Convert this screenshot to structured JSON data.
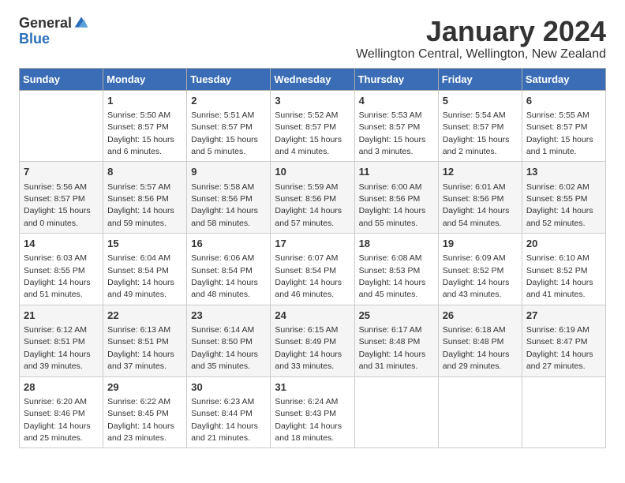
{
  "header": {
    "logo": {
      "general": "General",
      "blue": "Blue"
    },
    "month": "January 2024",
    "location": "Wellington Central, Wellington, New Zealand"
  },
  "columns": [
    "Sunday",
    "Monday",
    "Tuesday",
    "Wednesday",
    "Thursday",
    "Friday",
    "Saturday"
  ],
  "weeks": [
    [
      {
        "day": "",
        "info": ""
      },
      {
        "day": "1",
        "info": "Sunrise: 5:50 AM\nSunset: 8:57 PM\nDaylight: 15 hours\nand 6 minutes."
      },
      {
        "day": "2",
        "info": "Sunrise: 5:51 AM\nSunset: 8:57 PM\nDaylight: 15 hours\nand 5 minutes."
      },
      {
        "day": "3",
        "info": "Sunrise: 5:52 AM\nSunset: 8:57 PM\nDaylight: 15 hours\nand 4 minutes."
      },
      {
        "day": "4",
        "info": "Sunrise: 5:53 AM\nSunset: 8:57 PM\nDaylight: 15 hours\nand 3 minutes."
      },
      {
        "day": "5",
        "info": "Sunrise: 5:54 AM\nSunset: 8:57 PM\nDaylight: 15 hours\nand 2 minutes."
      },
      {
        "day": "6",
        "info": "Sunrise: 5:55 AM\nSunset: 8:57 PM\nDaylight: 15 hours\nand 1 minute."
      }
    ],
    [
      {
        "day": "7",
        "info": "Sunrise: 5:56 AM\nSunset: 8:57 PM\nDaylight: 15 hours\nand 0 minutes."
      },
      {
        "day": "8",
        "info": "Sunrise: 5:57 AM\nSunset: 8:56 PM\nDaylight: 14 hours\nand 59 minutes."
      },
      {
        "day": "9",
        "info": "Sunrise: 5:58 AM\nSunset: 8:56 PM\nDaylight: 14 hours\nand 58 minutes."
      },
      {
        "day": "10",
        "info": "Sunrise: 5:59 AM\nSunset: 8:56 PM\nDaylight: 14 hours\nand 57 minutes."
      },
      {
        "day": "11",
        "info": "Sunrise: 6:00 AM\nSunset: 8:56 PM\nDaylight: 14 hours\nand 55 minutes."
      },
      {
        "day": "12",
        "info": "Sunrise: 6:01 AM\nSunset: 8:56 PM\nDaylight: 14 hours\nand 54 minutes."
      },
      {
        "day": "13",
        "info": "Sunrise: 6:02 AM\nSunset: 8:55 PM\nDaylight: 14 hours\nand 52 minutes."
      }
    ],
    [
      {
        "day": "14",
        "info": "Sunrise: 6:03 AM\nSunset: 8:55 PM\nDaylight: 14 hours\nand 51 minutes."
      },
      {
        "day": "15",
        "info": "Sunrise: 6:04 AM\nSunset: 8:54 PM\nDaylight: 14 hours\nand 49 minutes."
      },
      {
        "day": "16",
        "info": "Sunrise: 6:06 AM\nSunset: 8:54 PM\nDaylight: 14 hours\nand 48 minutes."
      },
      {
        "day": "17",
        "info": "Sunrise: 6:07 AM\nSunset: 8:54 PM\nDaylight: 14 hours\nand 46 minutes."
      },
      {
        "day": "18",
        "info": "Sunrise: 6:08 AM\nSunset: 8:53 PM\nDaylight: 14 hours\nand 45 minutes."
      },
      {
        "day": "19",
        "info": "Sunrise: 6:09 AM\nSunset: 8:52 PM\nDaylight: 14 hours\nand 43 minutes."
      },
      {
        "day": "20",
        "info": "Sunrise: 6:10 AM\nSunset: 8:52 PM\nDaylight: 14 hours\nand 41 minutes."
      }
    ],
    [
      {
        "day": "21",
        "info": "Sunrise: 6:12 AM\nSunset: 8:51 PM\nDaylight: 14 hours\nand 39 minutes."
      },
      {
        "day": "22",
        "info": "Sunrise: 6:13 AM\nSunset: 8:51 PM\nDaylight: 14 hours\nand 37 minutes."
      },
      {
        "day": "23",
        "info": "Sunrise: 6:14 AM\nSunset: 8:50 PM\nDaylight: 14 hours\nand 35 minutes."
      },
      {
        "day": "24",
        "info": "Sunrise: 6:15 AM\nSunset: 8:49 PM\nDaylight: 14 hours\nand 33 minutes."
      },
      {
        "day": "25",
        "info": "Sunrise: 6:17 AM\nSunset: 8:48 PM\nDaylight: 14 hours\nand 31 minutes."
      },
      {
        "day": "26",
        "info": "Sunrise: 6:18 AM\nSunset: 8:48 PM\nDaylight: 14 hours\nand 29 minutes."
      },
      {
        "day": "27",
        "info": "Sunrise: 6:19 AM\nSunset: 8:47 PM\nDaylight: 14 hours\nand 27 minutes."
      }
    ],
    [
      {
        "day": "28",
        "info": "Sunrise: 6:20 AM\nSunset: 8:46 PM\nDaylight: 14 hours\nand 25 minutes."
      },
      {
        "day": "29",
        "info": "Sunrise: 6:22 AM\nSunset: 8:45 PM\nDaylight: 14 hours\nand 23 minutes."
      },
      {
        "day": "30",
        "info": "Sunrise: 6:23 AM\nSunset: 8:44 PM\nDaylight: 14 hours\nand 21 minutes."
      },
      {
        "day": "31",
        "info": "Sunrise: 6:24 AM\nSunset: 8:43 PM\nDaylight: 14 hours\nand 18 minutes."
      },
      {
        "day": "",
        "info": ""
      },
      {
        "day": "",
        "info": ""
      },
      {
        "day": "",
        "info": ""
      }
    ]
  ]
}
